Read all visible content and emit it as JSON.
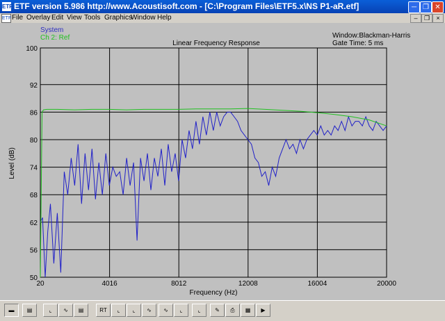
{
  "window": {
    "icon_label": "ETF",
    "title": "ETF version 5.986 http://www.Acoustisoft.com - [C:\\Program Files\\ETF5.x\\NS P1-aR.etf]"
  },
  "menu": {
    "items": [
      "File",
      "Overlay",
      "Edit",
      "View",
      "Tools",
      "Graphics",
      "Window",
      "Help"
    ]
  },
  "chart_info": {
    "window_label": "Window:Blackman-Harris",
    "gate_label": "Gate Time: 5 ms"
  },
  "toolbar": {
    "buttons": [
      "view-1-icon",
      "view-2-icon",
      "lin-icon",
      "wave-icon",
      "bars-icon",
      "rt-icon",
      "step-icon",
      "imp-icon",
      "freq-icon",
      "phase-icon",
      "spec-icon",
      "decay-icon",
      "pen-icon",
      "print-icon",
      "save-icon",
      "export-icon",
      "play-icon"
    ],
    "rt_label": "RT"
  },
  "chart_data": {
    "type": "line",
    "title": "Linear Frequency Response",
    "xlabel": "Frequency (Hz)",
    "ylabel": "Level (dB)",
    "xlim": [
      20,
      20000
    ],
    "ylim": [
      50,
      100
    ],
    "x_ticks": [
      "20",
      "4016",
      "8012",
      "12008",
      "16004",
      "20000"
    ],
    "y_ticks": [
      "100",
      "92",
      "86",
      "80",
      "74",
      "68",
      "62",
      "56",
      "50"
    ],
    "grid": true,
    "legend_position": "top-left",
    "colors": {
      "plot_bg": "#c0c0c0",
      "grid": "#000000"
    },
    "series": [
      {
        "name": "System",
        "color": "#2020c8",
        "x": [
          20,
          150,
          300,
          450,
          600,
          800,
          1000,
          1200,
          1400,
          1600,
          1800,
          2000,
          2200,
          2400,
          2600,
          2800,
          3000,
          3200,
          3400,
          3600,
          3800,
          4000,
          4200,
          4400,
          4600,
          4800,
          5000,
          5200,
          5400,
          5600,
          5800,
          6000,
          6200,
          6400,
          6600,
          6800,
          7000,
          7200,
          7400,
          7600,
          7800,
          8000,
          8200,
          8400,
          8600,
          8800,
          9000,
          9200,
          9400,
          9600,
          9800,
          10000,
          10200,
          10400,
          10600,
          10800,
          11000,
          11200,
          11400,
          11600,
          11800,
          12000,
          12200,
          12400,
          12600,
          12800,
          13000,
          13200,
          13400,
          13600,
          13800,
          14000,
          14200,
          14400,
          14600,
          14800,
          15000,
          15200,
          15400,
          15600,
          15800,
          16000,
          16200,
          16400,
          16600,
          16800,
          17000,
          17200,
          17400,
          17600,
          17800,
          18000,
          18200,
          18400,
          18600,
          18800,
          19000,
          19200,
          19400,
          19600,
          19800,
          20000
        ],
        "values": [
          62,
          63,
          50,
          60,
          66,
          53,
          64,
          51,
          73,
          68,
          76,
          70,
          79,
          66,
          77,
          69,
          78,
          67,
          75,
          68,
          77,
          70,
          74,
          72,
          73,
          68,
          76,
          70,
          75,
          58,
          76,
          71,
          77,
          69,
          76,
          72,
          78,
          70,
          79,
          73,
          77,
          71,
          80,
          76,
          82,
          78,
          84,
          79,
          85,
          81,
          86,
          82,
          86,
          83,
          85,
          86,
          86,
          85,
          84,
          82,
          81,
          80,
          79,
          76,
          75,
          72,
          73,
          70,
          74,
          72,
          76,
          78,
          80,
          78,
          79,
          77,
          80,
          78,
          80,
          81,
          82,
          81,
          83,
          81,
          82,
          81,
          83,
          82,
          84,
          82,
          85,
          83,
          84,
          84,
          83,
          85,
          83,
          82,
          84,
          83,
          82,
          83
        ]
      },
      {
        "name": "Ch 2: Ref",
        "color": "#20c020",
        "x": [
          20,
          120,
          200,
          400,
          1000,
          2000,
          3000,
          4000,
          5000,
          6000,
          7000,
          8000,
          9000,
          10000,
          11000,
          12000,
          13000,
          14000,
          15000,
          16000,
          17000,
          18000,
          19000,
          20000
        ],
        "values": [
          50,
          86,
          86.5,
          86.6,
          86.6,
          86.5,
          86.6,
          86.6,
          86.5,
          86.6,
          86.6,
          86.6,
          86.7,
          86.7,
          86.7,
          86.8,
          86.6,
          86.4,
          86.2,
          85.9,
          85.5,
          85.0,
          84.3,
          83.0
        ]
      }
    ]
  }
}
